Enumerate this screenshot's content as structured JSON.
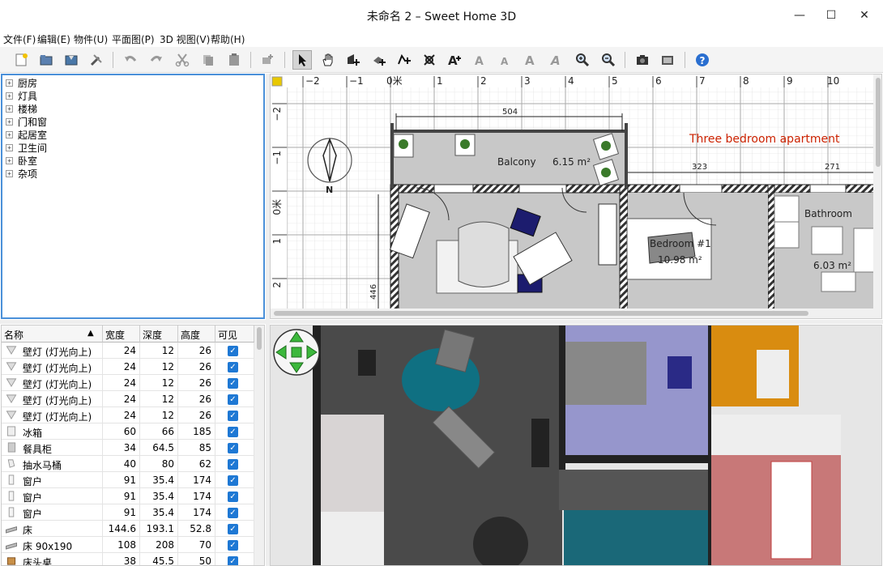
{
  "window": {
    "title": "未命名 2 – Sweet Home 3D",
    "minimize": "—",
    "maximize": "☐",
    "close": "✕"
  },
  "menu": [
    "文件(F)",
    "编辑(E)",
    "物件(U)",
    "平面图(P)",
    "3D 视图(V)",
    "帮助(H)"
  ],
  "toolbar": {
    "icons": [
      "new-home-icon",
      "open-icon",
      "save-icon",
      "preferences-icon",
      "undo-icon",
      "redo-icon",
      "cut-icon",
      "copy-icon",
      "paste-icon",
      "add-furniture-icon",
      "select-mode-icon",
      "pan-mode-icon",
      "create-walls-icon",
      "create-rooms-icon",
      "create-polylines-icon",
      "create-dimensions-icon",
      "create-labels-icon",
      "increase-text-icon",
      "decrease-text-icon",
      "bold-text-icon",
      "italic-text-icon",
      "zoom-in-icon",
      "zoom-out-icon",
      "create-photo-icon",
      "create-video-icon",
      "help-icon"
    ],
    "active": "select-mode-icon"
  },
  "catalog": {
    "categories": [
      "厨房",
      "灯具",
      "楼梯",
      "门和窗",
      "起居室",
      "卫生间",
      "卧室",
      "杂项"
    ],
    "expand_glyph": "+"
  },
  "furniture": {
    "columns": [
      "名称",
      "宽度",
      "深度",
      "高度",
      "可见"
    ],
    "sort_glyph": "▲",
    "check_glyph": "✓",
    "rows": [
      {
        "name": "壁灯 (灯光向上)",
        "width": "24",
        "depth": "12",
        "height": "26",
        "icon": "wall-lamp-icon"
      },
      {
        "name": "壁灯 (灯光向上)",
        "width": "24",
        "depth": "12",
        "height": "26",
        "icon": "wall-lamp-icon"
      },
      {
        "name": "壁灯 (灯光向上)",
        "width": "24",
        "depth": "12",
        "height": "26",
        "icon": "wall-lamp-icon"
      },
      {
        "name": "壁灯 (灯光向上)",
        "width": "24",
        "depth": "12",
        "height": "26",
        "icon": "wall-lamp-icon"
      },
      {
        "name": "壁灯 (灯光向上)",
        "width": "24",
        "depth": "12",
        "height": "26",
        "icon": "wall-lamp-icon"
      },
      {
        "name": "冰箱",
        "width": "60",
        "depth": "66",
        "height": "185",
        "icon": "fridge-icon"
      },
      {
        "name": "餐具柜",
        "width": "34",
        "depth": "64.5",
        "height": "85",
        "icon": "cupboard-icon"
      },
      {
        "name": "抽水马桶",
        "width": "40",
        "depth": "80",
        "height": "62",
        "icon": "toilet-icon"
      },
      {
        "name": "窗户",
        "width": "91",
        "depth": "35.4",
        "height": "174",
        "icon": "window-icon"
      },
      {
        "name": "窗户",
        "width": "91",
        "depth": "35.4",
        "height": "174",
        "icon": "window-icon"
      },
      {
        "name": "窗户",
        "width": "91",
        "depth": "35.4",
        "height": "174",
        "icon": "window-icon"
      },
      {
        "name": "床",
        "width": "144.6",
        "depth": "193.1",
        "height": "52.8",
        "icon": "bed-icon"
      },
      {
        "name": "床 90x190",
        "width": "108",
        "depth": "208",
        "height": "70",
        "icon": "bed-icon"
      },
      {
        "name": "床头桌",
        "width": "38",
        "depth": "45.5",
        "height": "50",
        "icon": "bedside-table-icon"
      }
    ]
  },
  "plan": {
    "ruler_top": [
      "−2",
      "−1",
      "0米",
      "1",
      "2",
      "3",
      "4",
      "5",
      "6",
      "7",
      "8",
      "9",
      "10"
    ],
    "ruler_left": [
      "−2",
      "−1",
      "0米",
      "1",
      "2"
    ],
    "label": "Three bedroom apartment",
    "label_color": "#cc2200",
    "dimensions": {
      "balcony_width": "504",
      "bedroom_width": "323",
      "bathroom_width": "271",
      "height": "446"
    },
    "rooms": [
      {
        "name": "Balcony",
        "area": "6.15 m²"
      },
      {
        "name": "Bedroom #1",
        "area": "10.98 m²"
      },
      {
        "name": "Bathroom",
        "area": "6.03 m²"
      }
    ],
    "compass_letter": "N"
  },
  "colors": {
    "accent": "#4a90d9",
    "checkbox": "#1e78d4",
    "wall_hatch": "#333333",
    "room_fill": "#c8c8c8"
  }
}
